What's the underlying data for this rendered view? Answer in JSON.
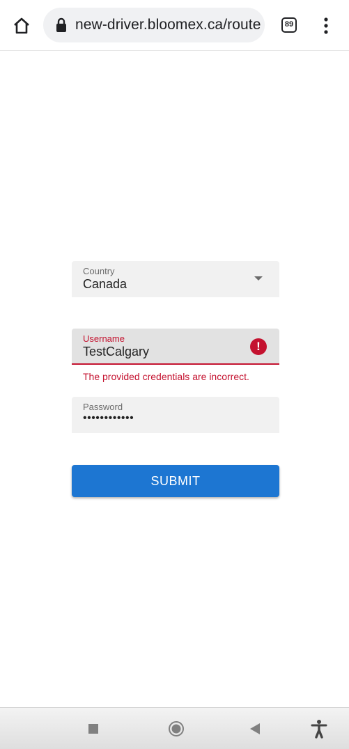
{
  "browser": {
    "url": "new-driver.bloomex.ca/route",
    "tab_count": "89",
    "icons": {
      "home": "home-icon",
      "lock": "lock-icon",
      "menu": "more-vert-icon"
    }
  },
  "form": {
    "country": {
      "label": "Country",
      "value": "Canada"
    },
    "username": {
      "label": "Username",
      "value": "TestCalgary",
      "error": "The provided credentials are incorrect."
    },
    "password": {
      "label": "Password",
      "value": "••••••••••••"
    },
    "submit_label": "SUBMIT"
  },
  "colors": {
    "primary": "#1d76d2",
    "error": "#c4122f",
    "field_background": "#f1f1f1"
  },
  "nav_bar": {
    "icons": [
      "recents-square-icon",
      "home-circle-icon",
      "back-triangle-icon",
      "accessibility-icon"
    ]
  }
}
